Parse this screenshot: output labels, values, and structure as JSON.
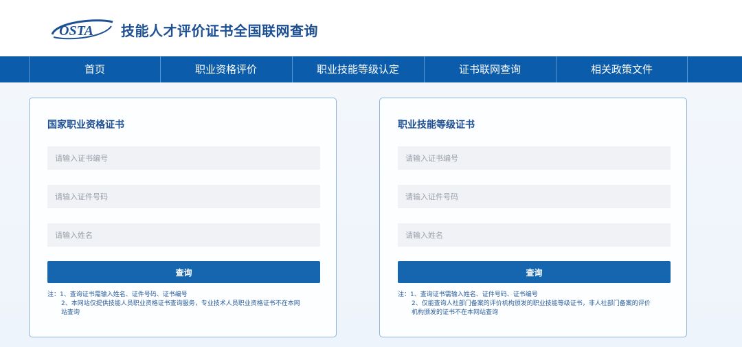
{
  "header": {
    "logo_text": "OSTA",
    "site_title": "技能人才评价证书全国联网查询"
  },
  "nav": {
    "items": [
      {
        "label": "首页"
      },
      {
        "label": "职业资格评价"
      },
      {
        "label": "职业技能等级认定"
      },
      {
        "label": "证书联网查询"
      },
      {
        "label": "相关政策文件"
      }
    ]
  },
  "cards": [
    {
      "title": "国家职业资格证书",
      "cert_placeholder": "请输入证书编号",
      "id_placeholder": "请输入证件号码",
      "name_placeholder": "请输入姓名",
      "submit_label": "查询",
      "notes": [
        "注：1、查询证书需输入姓名、证件号码、证书编号",
        "2、本网站仅提供技能人员职业资格证书查询服务，专业技术人员职业资格证书不在本网",
        "站查询"
      ]
    },
    {
      "title": "职业技能等级证书",
      "cert_placeholder": "请输入证书编号",
      "id_placeholder": "请输入证件号码",
      "name_placeholder": "请输入姓名",
      "submit_label": "查询",
      "notes": [
        "注：1、查询证书需输入姓名、证件号码、证书编号",
        "2、仅能查询人社部门备案的评价机构颁发的职业技能等级证书，非人社部门备案的评价",
        "机构颁发的证书不在本网站查询"
      ]
    }
  ],
  "colors": {
    "brand_blue": "#1d4f93",
    "nav_blue": "#0b5cab",
    "button_blue": "#1566ae",
    "card_border": "#8fb3df"
  }
}
